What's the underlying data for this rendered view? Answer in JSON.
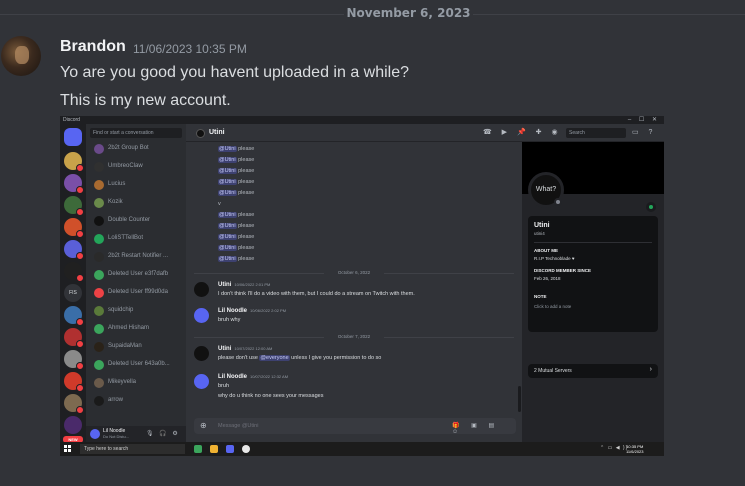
{
  "date_divider": "November 6, 2023",
  "message": {
    "author": "Brandon",
    "timestamp": "11/06/2023 10:35 PM",
    "lines": [
      "Yo are you good you havent uploaded in a while?",
      "This is my new account."
    ]
  },
  "screenshot": {
    "titlebar": {
      "title": "Discord",
      "controls": "– ☐ ✕"
    },
    "servers": {
      "label_fs": "FIS",
      "new_label": "NEW"
    },
    "dm_search_placeholder": "Find or start a conversation",
    "dms": [
      "2b2t Group Bot",
      "UmbreoClaw",
      "Lucius",
      "Kozik",
      "Double Counter",
      "LoliSTTellBot",
      "2b2t Restart Notifier ...",
      "Deleted User e3f7dafb",
      "Deleted User ff99d0da",
      "squidchip",
      "Ahmed Hisham",
      "SupaidaMan",
      "Deleted User 643a0b...",
      "Mikeyvella",
      "arrow"
    ],
    "user_panel": {
      "name": "Lil Noodle",
      "status": "Do Not Distu..."
    },
    "chat_header": {
      "name": "Utini",
      "search_placeholder": "Search"
    },
    "mentions": [
      {
        "at": "@Utini",
        "text": " please"
      },
      {
        "at": "@Utini",
        "text": " please"
      },
      {
        "at": "@Utini",
        "text": " please"
      },
      {
        "at": "@Utini",
        "text": " please"
      },
      {
        "at": "@Utini",
        "text": " please"
      },
      {
        "at": "",
        "text": "v"
      },
      {
        "at": "@Utini",
        "text": " please"
      },
      {
        "at": "@Utini",
        "text": " please"
      },
      {
        "at": "@Utini",
        "text": " please"
      },
      {
        "at": "@Utini",
        "text": " please"
      },
      {
        "at": "@Utini",
        "text": " please"
      }
    ],
    "dividers": [
      "October 6, 2022",
      "October 7, 2022"
    ],
    "messages": [
      {
        "author": "Utini",
        "time": "10/06/2022 2:01 PM",
        "lines": [
          "I don't think I'll do a video with them, but I could do a stream on Twitch with them."
        ]
      },
      {
        "author": "Lil Noodle",
        "time": "10/06/2022 2:02 PM",
        "lines": [
          "bruh why"
        ]
      },
      {
        "author": "Utini",
        "time": "10/07/2022 12:00 AM",
        "pre": "please don't use ",
        "at": "@everyone",
        "post": " unless I give you permission to do so"
      },
      {
        "author": "Lil Noodle",
        "time": "10/07/2022 12:32 AM",
        "lines": [
          "bruh",
          "why do u think no one sees your messages"
        ]
      }
    ],
    "input_placeholder": "Message @Utini",
    "profile": {
      "avatar_text": "What?",
      "name": "Utini",
      "tag": "utini4",
      "about_label": "ABOUT ME",
      "about": "R.I.P Technoblade ♥",
      "member_since_label": "DISCORD MEMBER SINCE",
      "member_since": "Feb 26, 2018",
      "note_label": "NOTE",
      "note_placeholder": "Click to add a note",
      "mutual": "2 Mutual Servers"
    },
    "taskbar": {
      "search": "Type here to search",
      "time": "10:35 PM",
      "date": "11/6/2023"
    }
  }
}
